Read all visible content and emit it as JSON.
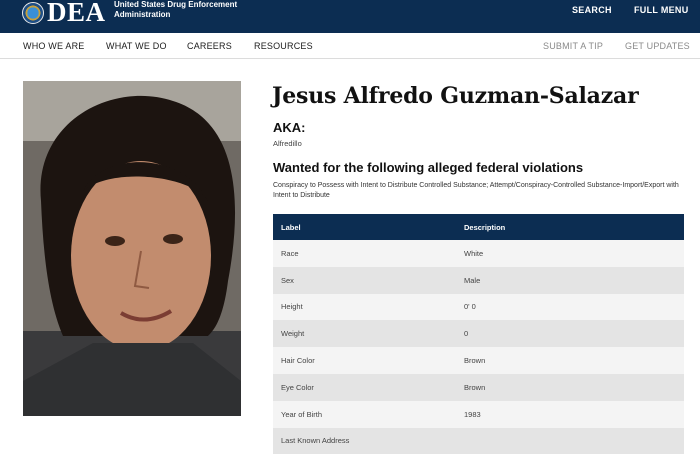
{
  "header": {
    "logo_text": "DEA",
    "agency_line1": "United States Drug Enforcement",
    "agency_line2": "Administration",
    "search_label": "SEARCH",
    "menu_label": "FULL MENU"
  },
  "nav": {
    "items": [
      "WHO WE ARE",
      "WHAT WE DO",
      "CAREERS",
      "RESOURCES"
    ],
    "submit_tip": "SUBMIT A TIP",
    "get_updates": "GET UPDATES"
  },
  "fugitive": {
    "name": "Jesus Alfredo Guzman-Salazar",
    "aka_heading": "AKA:",
    "aka_value": "Alfredillo",
    "violations_heading": "Wanted for the following alleged federal violations",
    "violations_text": "Conspiracy to Possess with Intent to Distribute Controlled Substance; Attempt/Conspiracy-Controlled Substance-Import/Export with Intent to Distribute"
  },
  "table": {
    "headers": [
      "Label",
      "Description"
    ],
    "rows": [
      [
        "Race",
        "White"
      ],
      [
        "Sex",
        "Male"
      ],
      [
        "Height",
        "0' 0"
      ],
      [
        "Weight",
        "0"
      ],
      [
        "Hair Color",
        "Brown"
      ],
      [
        "Eye Color",
        "Brown"
      ],
      [
        "Year of Birth",
        "1983"
      ],
      [
        "Last Known Address",
        ""
      ]
    ]
  },
  "colors": {
    "header_bg": "#0c2d52",
    "table_header_bg": "#0c2d52"
  }
}
